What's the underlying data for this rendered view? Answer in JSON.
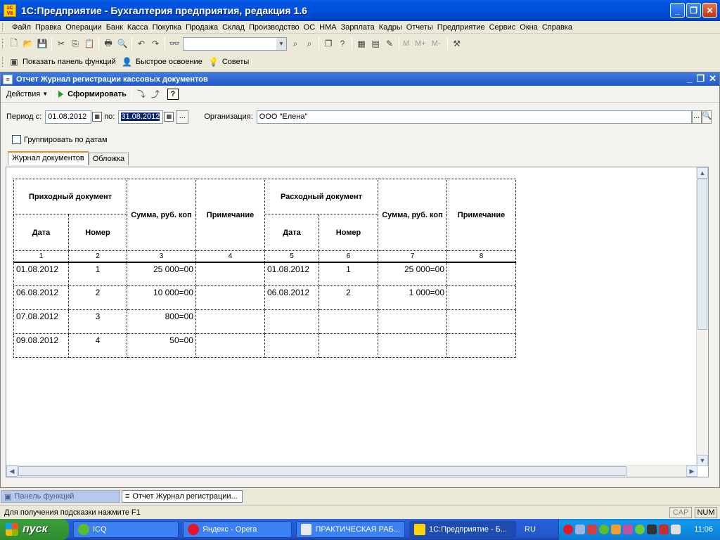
{
  "app": {
    "title": "1С:Предприятие - Бухгалтерия предприятия, редакция 1.6",
    "logo_text": "1С V8"
  },
  "menu": [
    "Файл",
    "Правка",
    "Операции",
    "Банк",
    "Касса",
    "Покупка",
    "Продажа",
    "Склад",
    "Производство",
    "ОС",
    "НМА",
    "Зарплата",
    "Кадры",
    "Отчеты",
    "Предприятие",
    "Сервис",
    "Окна",
    "Справка"
  ],
  "toolbar2": {
    "show_panel": "Показать панель функций",
    "quick_start": "Быстрое освоение",
    "tips": "Советы"
  },
  "toolbar_misc": {
    "m": "M",
    "m_plus": "M+",
    "m_minus": "M-"
  },
  "document": {
    "title": "Отчет Журнал регистрации кассовых документов",
    "actions_label": "Действия",
    "generate_label": "Сформировать",
    "period_from_label": "Период с:",
    "period_from": "01.08.2012",
    "period_to_label": "по:",
    "period_to": "31.08.2012",
    "org_label": "Организация:",
    "org_value": "ООО \"Елена\"",
    "group_by_dates_label": "Группировать по датам",
    "tabs": [
      "Журнал документов",
      "Обложка"
    ]
  },
  "report": {
    "headers": {
      "incoming_doc": "Приходный документ",
      "outgoing_doc": "Расходный документ",
      "date": "Дата",
      "number": "Номер",
      "sum": "Сумма, руб. коп",
      "note": "Примечание"
    },
    "column_numbers": [
      "1",
      "2",
      "3",
      "4",
      "5",
      "6",
      "7",
      "8"
    ],
    "rows": [
      {
        "in_date": "01.08.2012",
        "in_num": "1",
        "in_sum": "25 000=00",
        "in_note": "",
        "out_date": "01.08.2012",
        "out_num": "1",
        "out_sum": "25 000=00",
        "out_note": ""
      },
      {
        "in_date": "06.08.2012",
        "in_num": "2",
        "in_sum": "10 000=00",
        "in_note": "",
        "out_date": "06.08.2012",
        "out_num": "2",
        "out_sum": "1 000=00",
        "out_note": ""
      },
      {
        "in_date": "07.08.2012",
        "in_num": "3",
        "in_sum": "800=00",
        "in_note": "",
        "out_date": "",
        "out_num": "",
        "out_sum": "",
        "out_note": ""
      },
      {
        "in_date": "09.08.2012",
        "in_num": "4",
        "in_sum": "50=00",
        "in_note": "",
        "out_date": "",
        "out_num": "",
        "out_sum": "",
        "out_note": ""
      }
    ]
  },
  "window_bar": {
    "panel_tab": "Панель функций",
    "report_tab": "Отчет Журнал регистрации..."
  },
  "status": {
    "hint": "Для получения подсказки нажмите F1",
    "caps": "CAP",
    "num": "NUM"
  },
  "taskbar": {
    "start": "пуск",
    "items": [
      "ICQ",
      "Яндекс - Opera",
      "ПРАКТИЧЕСКАЯ РАБ...",
      "1С:Предприятие - Б..."
    ],
    "lang": "RU",
    "clock": "11:06"
  }
}
